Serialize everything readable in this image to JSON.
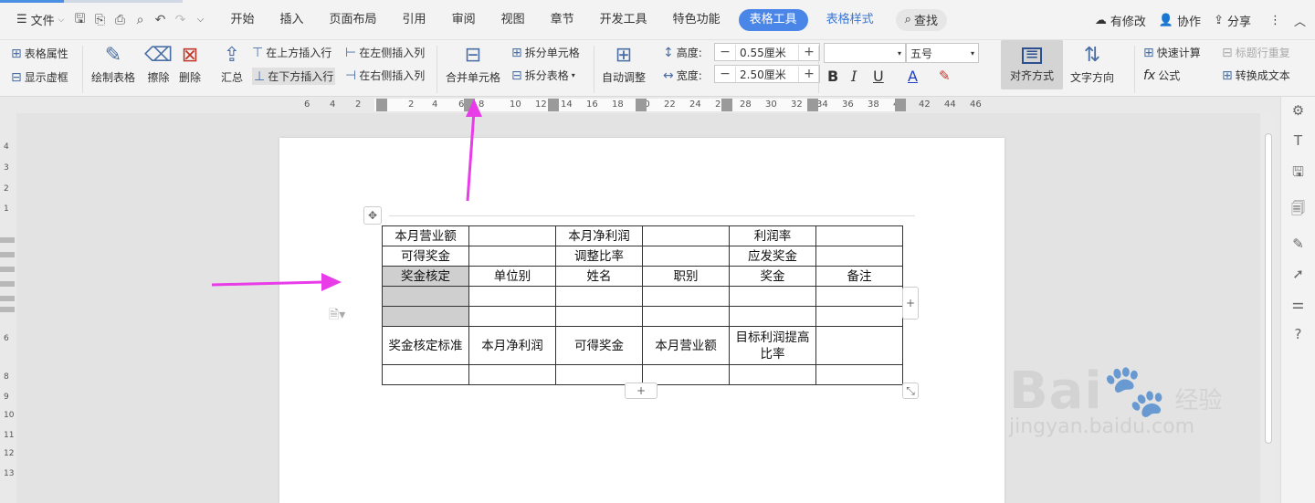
{
  "menubar": {
    "file_label": "文件",
    "tabs": [
      "开始",
      "插入",
      "页面布局",
      "引用",
      "审阅",
      "视图",
      "章节",
      "开发工具",
      "特色功能"
    ],
    "active_tab": "表格工具",
    "second_tab": "表格样式",
    "search_label": "查找",
    "right": {
      "modified": "有修改",
      "collab": "协作",
      "share": "分享"
    }
  },
  "ribbon": {
    "table_props": "表格属性",
    "show_gridlines": "显示虚框",
    "draw_table": "绘制表格",
    "erase": "擦除",
    "delete": "删除",
    "summary": "汇总",
    "insert_above": "在上方插入行",
    "insert_below": "在下方插入行",
    "insert_left": "在左侧插入列",
    "insert_right": "在右侧插入列",
    "merge_cells": "合并单元格",
    "split_cells": "拆分单元格",
    "split_table": "拆分表格",
    "auto_fit": "自动调整",
    "height_label": "高度:",
    "height_value": "0.55厘米",
    "width_label": "宽度:",
    "width_value": "2.50厘米",
    "font_size": "五号",
    "bold": "B",
    "italic": "I",
    "underline": "U",
    "font_color": "A",
    "align": "对齐方式",
    "text_direction": "文字方向",
    "quick_calc": "快速计算",
    "repeat_header": "标题行重复",
    "formula": "公式",
    "to_text": "转换成文本"
  },
  "ruler": {
    "labels": [
      "6",
      "4",
      "2",
      "2",
      "4",
      "6",
      "8",
      "10",
      "12",
      "14",
      "16",
      "18",
      "20",
      "22",
      "24",
      "26",
      "28",
      "30",
      "32",
      "34",
      "36",
      "38",
      "40",
      "42",
      "44",
      "46"
    ],
    "v_labels": [
      "4",
      "3",
      "2",
      "1",
      "6",
      "8",
      "9",
      "10",
      "11",
      "12",
      "13"
    ]
  },
  "table": {
    "rows": [
      [
        "本月营业额",
        "",
        "本月净利润",
        "",
        "利润率",
        ""
      ],
      [
        "可得奖金",
        "",
        "调整比率",
        "",
        "应发奖金",
        ""
      ],
      [
        "奖金核定",
        "单位别",
        "姓名",
        "职别",
        "奖金",
        "备注"
      ],
      [
        "",
        "",
        "",
        "",
        "",
        ""
      ],
      [
        "",
        "",
        "",
        "",
        "",
        ""
      ],
      [
        "奖金核定标准",
        "本月净利润",
        "可得奖金",
        "本月营业额",
        "目标利润提高比率",
        ""
      ],
      [
        "",
        "",
        "",
        "",
        "",
        ""
      ]
    ]
  },
  "watermark": {
    "brand": "Bai",
    "suffix": "经验",
    "url": "jingyan.baidu.com"
  },
  "colors": {
    "accent": "#4a86e8",
    "arrow": "#e83ce8"
  }
}
